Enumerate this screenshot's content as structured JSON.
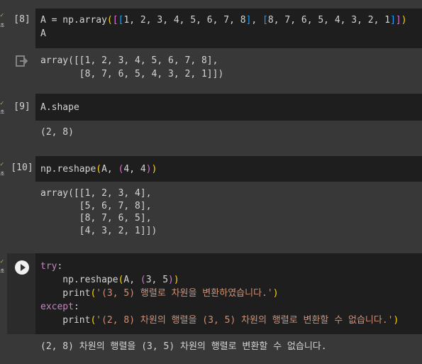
{
  "cells": [
    {
      "exec_label": "[8]",
      "status_label": "초",
      "code_lines": [
        "A = np.array([[1, 2, 3, 4, 5, 6, 7, 8], [8, 7, 6, 5, 4, 3, 2, 1]])",
        "A"
      ],
      "output_lines": [
        "array([[1, 2, 3, 4, 5, 6, 7, 8],",
        "       [8, 7, 6, 5, 4, 3, 2, 1]])"
      ]
    },
    {
      "exec_label": "[9]",
      "status_label": "초",
      "code_lines": [
        "A.shape"
      ],
      "output_lines": [
        "(2, 8)"
      ]
    },
    {
      "exec_label": "[10]",
      "status_label": "초",
      "code_lines": [
        "np.reshape(A, (4, 4))"
      ],
      "output_lines": [
        "array([[1, 2, 3, 4],",
        "       [5, 6, 7, 8],",
        "       [8, 7, 6, 5],",
        "       [4, 3, 2, 1]])"
      ]
    },
    {
      "exec_label": "",
      "status_label": "초",
      "code_lines": [
        "try:",
        "    np.reshape(A, (3, 5))",
        "    print('(3, 5) 행렬로 차원을 변환하였습니다.')",
        "except:",
        "    print('(2, 8) 차원의 행렬을 (3, 5) 차원의 행렬로 변환할 수 없습니다.')"
      ],
      "output_lines": [
        "(2, 8) 차원의 행렬을 (3, 5) 차원의 행렬로 변환할 수 없습니다."
      ]
    }
  ],
  "icons": {
    "check": "check-icon",
    "output": "output-redirect-icon",
    "run": "play-icon"
  },
  "colors": {
    "code_bg": "#1e1e1e",
    "page_bg": "#383838",
    "bracket_gold": "#ffd700",
    "bracket_pink": "#da70d6",
    "bracket_blue": "#179fff",
    "string": "#ce9178",
    "keyword": "#c586c0",
    "check": "#8bc34a"
  }
}
